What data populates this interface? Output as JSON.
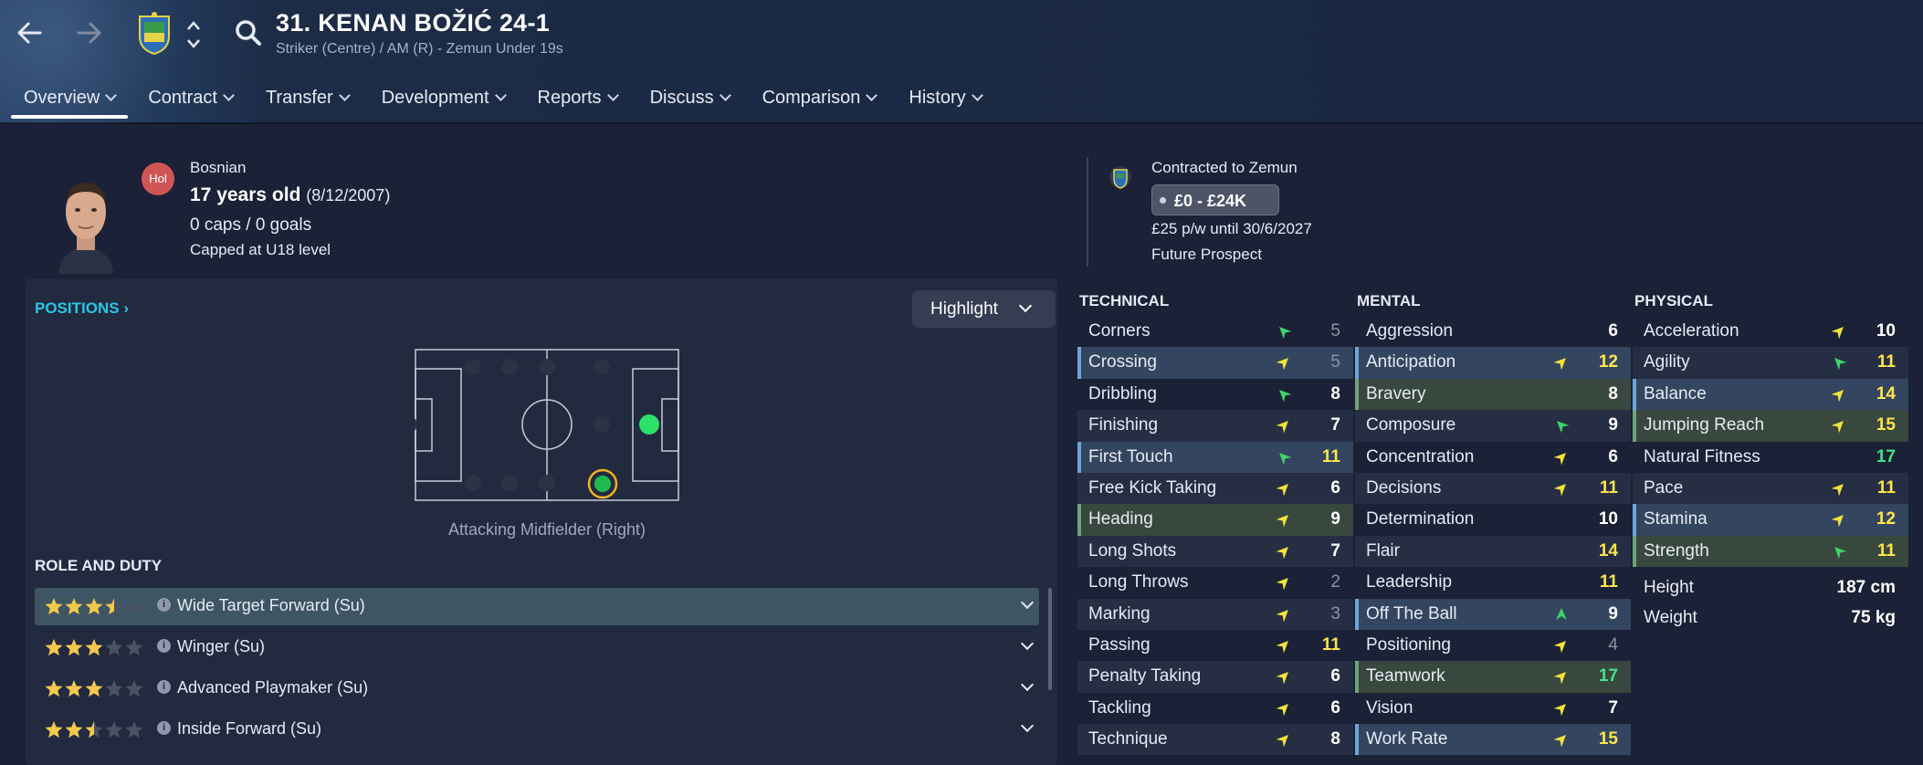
{
  "header": {
    "player_title": "31. KENAN BOŽIĆ 24-1",
    "player_subtitle": "Striker (Centre) / AM (R) - Zemun Under 19s",
    "icons": [
      "back-arrow-icon",
      "forward-arrow-icon",
      "club-crest-icon",
      "up-down-icon",
      "search-icon"
    ]
  },
  "tabs": [
    {
      "label": "Overview",
      "active": true
    },
    {
      "label": "Contract"
    },
    {
      "label": "Transfer"
    },
    {
      "label": "Development"
    },
    {
      "label": "Reports"
    },
    {
      "label": "Discuss"
    },
    {
      "label": "Comparison"
    },
    {
      "label": "History"
    }
  ],
  "profile": {
    "badge": "Hol",
    "nationality": "Bosnian",
    "age": "17 years old",
    "dob": "(8/12/2007)",
    "caps": "0 caps / 0 goals",
    "capped_level": "Capped at U18 level",
    "contracted": "Contracted to Zemun",
    "value": "£0 - £24K",
    "wage": "£25 p/w until 30/6/2027",
    "status": "Future Prospect"
  },
  "positions": {
    "link_label": "POSITIONS",
    "highlight_label": "Highlight",
    "selected_position": "Attacking Midfielder (Right)"
  },
  "roles": {
    "title": "ROLE AND DUTY",
    "items": [
      {
        "name": "Wide Target Forward (Su)",
        "stars": 3.5,
        "selected": true
      },
      {
        "name": "Winger (Su)",
        "stars": 3
      },
      {
        "name": "Advanced Playmaker (Su)",
        "stars": 3
      },
      {
        "name": "Inside Forward (Su)",
        "stars": 2.5
      }
    ]
  },
  "attributes": {
    "technical": {
      "title": "TECHNICAL",
      "items": [
        {
          "name": "Corners",
          "value": "5",
          "arrow": "up-left",
          "tone": "grey"
        },
        {
          "name": "Crossing",
          "value": "5",
          "arrow": "up-right",
          "tone": "grey",
          "hl": "blue"
        },
        {
          "name": "Dribbling",
          "value": "8",
          "arrow": "up-left",
          "tone": "white"
        },
        {
          "name": "Finishing",
          "value": "7",
          "arrow": "up-right",
          "tone": "white"
        },
        {
          "name": "First Touch",
          "value": "11",
          "arrow": "up-left",
          "tone": "yellow",
          "hl": "blue"
        },
        {
          "name": "Free Kick Taking",
          "value": "6",
          "arrow": "up-right",
          "tone": "white"
        },
        {
          "name": "Heading",
          "value": "9",
          "arrow": "up-right",
          "tone": "white",
          "hl": "green"
        },
        {
          "name": "Long Shots",
          "value": "7",
          "arrow": "up-right",
          "tone": "white"
        },
        {
          "name": "Long Throws",
          "value": "2",
          "arrow": "up-right",
          "tone": "grey"
        },
        {
          "name": "Marking",
          "value": "3",
          "arrow": "up-right",
          "tone": "grey"
        },
        {
          "name": "Passing",
          "value": "11",
          "arrow": "up-right",
          "tone": "yellow"
        },
        {
          "name": "Penalty Taking",
          "value": "6",
          "arrow": "up-right",
          "tone": "white"
        },
        {
          "name": "Tackling",
          "value": "6",
          "arrow": "up-right",
          "tone": "white"
        },
        {
          "name": "Technique",
          "value": "8",
          "arrow": "up-right",
          "tone": "white"
        }
      ]
    },
    "mental": {
      "title": "MENTAL",
      "items": [
        {
          "name": "Aggression",
          "value": "6",
          "tone": "white"
        },
        {
          "name": "Anticipation",
          "value": "12",
          "arrow": "up-right",
          "tone": "yellow",
          "hl": "blue"
        },
        {
          "name": "Bravery",
          "value": "8",
          "tone": "white",
          "hl": "green"
        },
        {
          "name": "Composure",
          "value": "9",
          "arrow": "up-left",
          "tone": "white"
        },
        {
          "name": "Concentration",
          "value": "6",
          "arrow": "up-right",
          "tone": "white"
        },
        {
          "name": "Decisions",
          "value": "11",
          "arrow": "up-right",
          "tone": "yellow"
        },
        {
          "name": "Determination",
          "value": "10",
          "tone": "white"
        },
        {
          "name": "Flair",
          "value": "14",
          "tone": "yellow"
        },
        {
          "name": "Leadership",
          "value": "11",
          "tone": "yellow"
        },
        {
          "name": "Off The Ball",
          "value": "9",
          "arrow": "up",
          "tone": "white",
          "hl": "blue"
        },
        {
          "name": "Positioning",
          "value": "4",
          "arrow": "up-right",
          "tone": "grey"
        },
        {
          "name": "Teamwork",
          "value": "17",
          "arrow": "up-right",
          "tone": "green",
          "hl": "green"
        },
        {
          "name": "Vision",
          "value": "7",
          "arrow": "up-right",
          "tone": "white"
        },
        {
          "name": "Work Rate",
          "value": "15",
          "arrow": "up-right",
          "tone": "yellow",
          "hl": "blue"
        }
      ]
    },
    "physical": {
      "title": "PHYSICAL",
      "items": [
        {
          "name": "Acceleration",
          "value": "10",
          "arrow": "up-right",
          "tone": "white"
        },
        {
          "name": "Agility",
          "value": "11",
          "arrow": "up-left",
          "tone": "yellow"
        },
        {
          "name": "Balance",
          "value": "14",
          "arrow": "up-right",
          "tone": "yellow",
          "hl": "blue"
        },
        {
          "name": "Jumping Reach",
          "value": "15",
          "arrow": "up-right",
          "tone": "yellow",
          "hl": "green"
        },
        {
          "name": "Natural Fitness",
          "value": "17",
          "tone": "green"
        },
        {
          "name": "Pace",
          "value": "11",
          "arrow": "up-right",
          "tone": "yellow"
        },
        {
          "name": "Stamina",
          "value": "12",
          "arrow": "up-right",
          "tone": "yellow",
          "hl": "blue"
        },
        {
          "name": "Strength",
          "value": "11",
          "arrow": "up-left",
          "tone": "yellow",
          "hl": "green"
        }
      ],
      "extras": [
        {
          "name": "Height",
          "value": "187 cm"
        },
        {
          "name": "Weight",
          "value": "75 kg"
        }
      ]
    }
  },
  "colors": {
    "background": "#1b2136",
    "accent_cyan": "#28c7e6",
    "value_yellow": "#ffe54d",
    "value_green": "#45e08a",
    "arrow_yellow": "#f2e23a",
    "arrow_green": "#3fd36b"
  }
}
